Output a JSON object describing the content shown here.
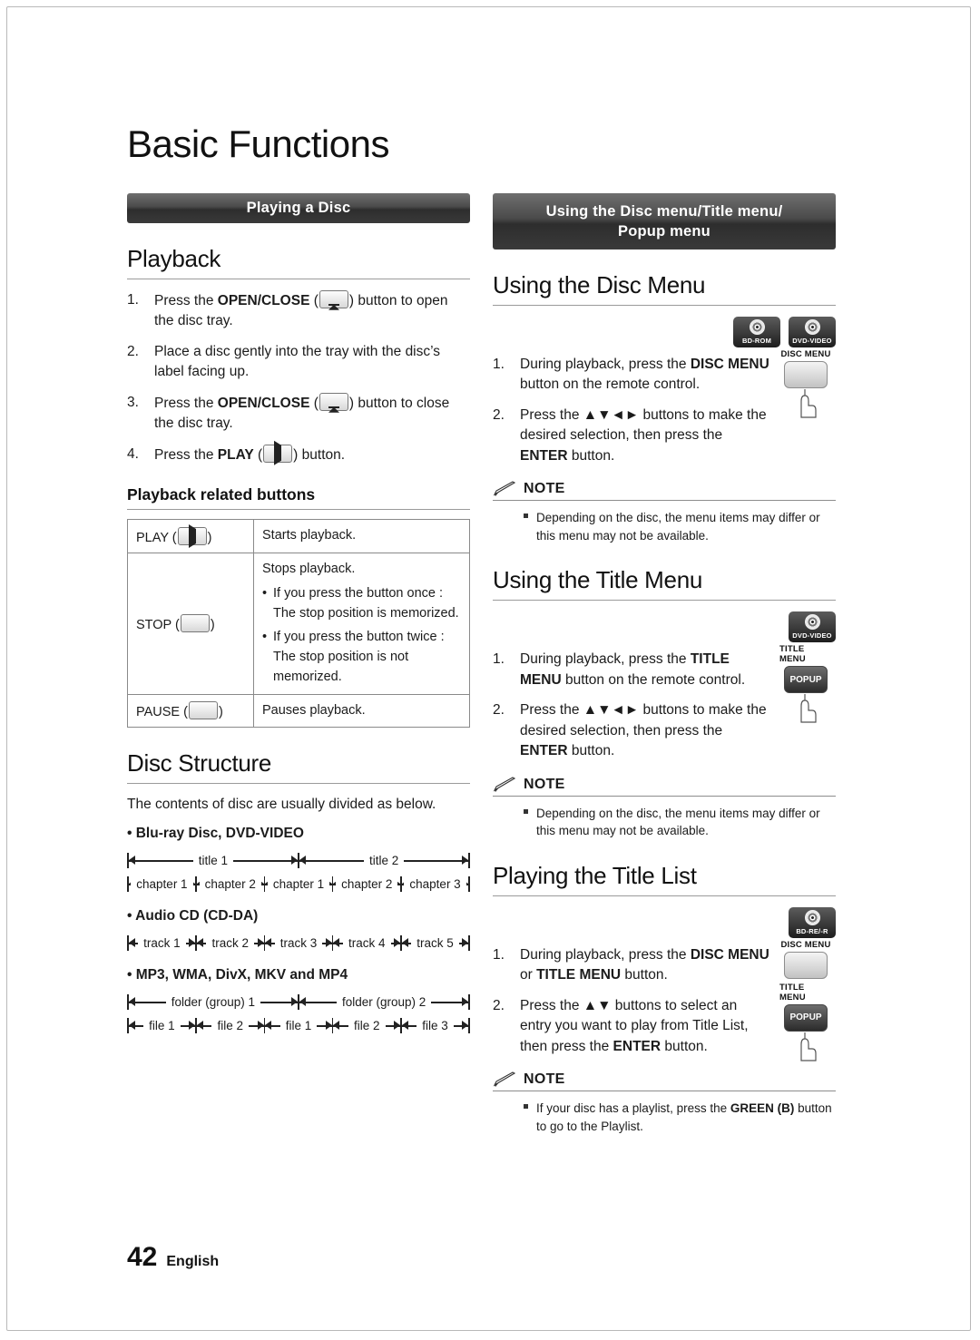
{
  "chapter": {
    "title": "Basic Functions"
  },
  "left": {
    "banner": "Playing a Disc",
    "playback": {
      "heading": "Playback",
      "steps": [
        {
          "num": "1.",
          "pre": "Press the ",
          "bold": "OPEN/CLOSE",
          "icon": "eject-icon",
          "post": " button to open the disc tray."
        },
        {
          "num": "2.",
          "pre": "Place a disc gently into the tray with the disc’s label facing up.",
          "bold": "",
          "post": ""
        },
        {
          "num": "3.",
          "pre": "Press the ",
          "bold": "OPEN/CLOSE",
          "icon": "eject-icon",
          "post": " button to close the disc tray."
        },
        {
          "num": "4.",
          "pre": "Press the ",
          "bold": "PLAY",
          "icon": "play-icon",
          "post": " button."
        }
      ]
    },
    "related": {
      "heading": "Playback related buttons",
      "rows": [
        {
          "key": "PLAY (",
          "key_icon": "play-icon",
          "key_close": ")",
          "lines": [
            {
              "bullet": false,
              "text": "Starts playback."
            }
          ]
        },
        {
          "key": "STOP (",
          "key_icon": "stop-icon",
          "key_close": ")",
          "lines": [
            {
              "bullet": false,
              "text": "Stops playback."
            },
            {
              "bullet": true,
              "text": "If you press the button once : The stop position is memorized."
            },
            {
              "bullet": true,
              "text": "If you press the button twice : The stop position is not memorized."
            }
          ]
        },
        {
          "key": "PAUSE (",
          "key_icon": "pause-icon",
          "key_close": ")",
          "lines": [
            {
              "bullet": false,
              "text": "Pauses playback."
            }
          ]
        }
      ]
    },
    "disc_structure": {
      "heading": "Disc Structure",
      "intro": "The contents of disc are usually divided as below.",
      "groups": [
        {
          "label": "Blu-ray Disc, DVD-VIDEO",
          "rows": [
            {
              "cells": [
                "title 1",
                "title 2"
              ]
            },
            {
              "cells": [
                "chapter 1",
                "chapter 2",
                "chapter 1",
                "chapter 2",
                "chapter 3"
              ]
            }
          ]
        },
        {
          "label": "Audio CD (CD-DA)",
          "rows": [
            {
              "cells": [
                "track 1",
                "track 2",
                "track 3",
                "track 4",
                "track 5"
              ]
            }
          ]
        },
        {
          "label": "MP3, WMA, DivX, MKV and MP4",
          "rows": [
            {
              "cells": [
                "folder (group) 1",
                "folder (group) 2"
              ]
            },
            {
              "cells": [
                "file 1",
                "file 2",
                "file 1",
                "file 2",
                "file 3"
              ]
            }
          ]
        }
      ]
    }
  },
  "right": {
    "banner_line1": "Using the Disc menu/Title menu/",
    "banner_line2": "Popup menu",
    "disc_menu": {
      "heading": "Using the Disc Menu",
      "badges": [
        {
          "label": "BD-ROM"
        },
        {
          "label": "DVD-VIDEO"
        }
      ],
      "remote": {
        "key_label": "DISC MENU",
        "key_text": ""
      },
      "steps": [
        {
          "num": "1.",
          "parts": [
            {
              "t": "During playback, press the ",
              "b": false
            },
            {
              "t": "DISC MENU",
              "b": true
            },
            {
              "t": " button on the remote control.",
              "b": false
            }
          ]
        },
        {
          "num": "2.",
          "parts": [
            {
              "t": "Press the ▲▼◄► buttons to make the desired selection, then press the ",
              "b": false
            },
            {
              "t": "ENTER",
              "b": true
            },
            {
              "t": " button.",
              "b": false
            }
          ]
        }
      ],
      "note_label": "NOTE",
      "note": "Depending on the disc, the menu items may differ or this menu may not be available."
    },
    "title_menu": {
      "heading": "Using the Title Menu",
      "badges": [
        {
          "label": "DVD-VIDEO"
        }
      ],
      "remote": {
        "key_label": "TITLE MENU",
        "key_text": "POPUP"
      },
      "steps": [
        {
          "num": "1.",
          "parts": [
            {
              "t": "During playback, press the ",
              "b": false
            },
            {
              "t": "TITLE MENU",
              "b": true
            },
            {
              "t": " button on the remote control.",
              "b": false
            }
          ]
        },
        {
          "num": "2.",
          "parts": [
            {
              "t": "Press the ▲▼◄► buttons to make the desired selection, then press the ",
              "b": false
            },
            {
              "t": "ENTER",
              "b": true
            },
            {
              "t": " button.",
              "b": false
            }
          ]
        }
      ],
      "note_label": "NOTE",
      "note": "Depending on the disc, the menu items may differ or this menu may not be available."
    },
    "title_list": {
      "heading": "Playing the Title List",
      "badges": [
        {
          "label": "BD-RE/-R"
        }
      ],
      "remote": {
        "key_label_1": "DISC MENU",
        "key_label_2": "TITLE MENU",
        "key_text_2": "POPUP"
      },
      "steps": [
        {
          "num": "1.",
          "parts": [
            {
              "t": "During playback, press the ",
              "b": false
            },
            {
              "t": "DISC MENU",
              "b": true
            },
            {
              "t": " or ",
              "b": false
            },
            {
              "t": "TITLE MENU",
              "b": true
            },
            {
              "t": " button.",
              "b": false
            }
          ]
        },
        {
          "num": "2.",
          "parts": [
            {
              "t": "Press the ▲▼ buttons to select an entry you want to play from Title List, then press the ",
              "b": false
            },
            {
              "t": "ENTER",
              "b": true
            },
            {
              "t": " button.",
              "b": false
            }
          ]
        }
      ],
      "note_label": "NOTE",
      "note_parts": [
        {
          "t": "If your disc has a playlist, press the ",
          "b": false
        },
        {
          "t": "GREEN (B)",
          "b": true
        },
        {
          "t": " button to go to the Playlist.",
          "b": false
        }
      ]
    }
  },
  "footer": {
    "page": "42",
    "language": "English"
  }
}
